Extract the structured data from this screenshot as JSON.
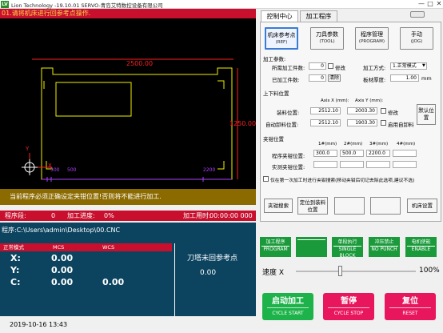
{
  "titlebar": {
    "title": "Lion Technology -19.10.01 SERVO-青岛艾特数控设备有限公司",
    "logo_text": "LV",
    "minimize": "—",
    "maximize": "□",
    "close": "✕"
  },
  "message": "01.请将机床进行回参考点操作.",
  "canvas": {
    "dim_x": "2500.00",
    "dim_y": "1250.00",
    "tick_a": "500",
    "tick_b": "500",
    "tick_c": "2200",
    "axis_x": "X",
    "axis_y": "Y"
  },
  "warning": "当前程序必须正确设定夹钳位置!否则将不能进行加工.",
  "progress": {
    "seg_label": "程序段:",
    "seg_value": "0",
    "progress_label": "加工进度:",
    "progress_value": "0%",
    "time_label": "加工用时:",
    "time_value": "00:00:00 000"
  },
  "program": {
    "path": "程序:C:\\Users\\admin\\Desktop\\00.CNC"
  },
  "coords": {
    "header_mode": "正常模式",
    "header_mcs": "MCS",
    "header_wcs": "WCS",
    "rows": [
      {
        "axis": "X:",
        "mcs": "0.00",
        "wcs": ""
      },
      {
        "axis": "Y:",
        "mcs": "0.00",
        "wcs": ""
      },
      {
        "axis": "C:",
        "mcs": "0.00",
        "wcs": "0.00"
      }
    ],
    "tool_title": "刀塔未回参考点",
    "tool_value": "0.00"
  },
  "status": {
    "datetime": "2019-10-16 13:43"
  },
  "tabs": [
    {
      "label": "控制中心"
    },
    {
      "label": "加工程序"
    }
  ],
  "modes": [
    {
      "label": "机床参考点",
      "sub": "(REF)"
    },
    {
      "label": "刀具参数",
      "sub": "(TOOL)"
    },
    {
      "label": "程序管理",
      "sub": "(PROGRAM)"
    },
    {
      "label": "手动",
      "sub": "(JOG)"
    }
  ],
  "params": {
    "section": "加工参数:",
    "total_label": "所需加工件数:",
    "total_value": "0",
    "modify": "修改",
    "done_label": "已加工件数:",
    "done_value": "0",
    "clear": "清除",
    "method_label": "加工方式:",
    "method_value": "1.正常模式",
    "thickness_label": "板材厚度:",
    "thickness_value": "1.00",
    "thickness_unit": "mm"
  },
  "loading": {
    "section": "上下料位置",
    "axisx_label": "Axis X (mm):",
    "axisy_label": "Axis Y (mm):",
    "load_label": "装料位置:",
    "load_x": "2512.10",
    "load_y": "2003.30",
    "load_mod": "修改",
    "unload_label": "自动卸料位置:",
    "unload_x": "2512.10",
    "unload_y": "1903.30",
    "unload_enable": "启用自卸料",
    "default_btn": "默认位置"
  },
  "clamps": {
    "section": "夹钳位置",
    "h1": "1#(mm)",
    "h2": "2#(mm)",
    "h3": "3#(mm)",
    "h4": "4#(mm)",
    "prog_label": "程序夹钳位置:",
    "p1": "300.0",
    "p2": "500.0",
    "p3": "2200.0",
    "p4": "",
    "actual_label": "实测夹钳位置:",
    "note": "仅在第一次加工时进行夹钳搜索(移动夹钳后切记去除此选项,建议不选)"
  },
  "bottom_buttons": {
    "search": "夹钳搜索",
    "locate": "定位到装料位置",
    "settings": "机床设置"
  },
  "green_buttons": [
    {
      "top": "加工程序",
      "bottom": "PROGRAM"
    },
    {
      "top": "",
      "bottom": ""
    },
    {
      "top": "单段执行",
      "bottom": "SINGLE BLOCK"
    },
    {
      "top": "冲压禁止",
      "bottom": "NO PUNCH"
    },
    {
      "top": "电机使能",
      "bottom": "ENABLE"
    }
  ],
  "speed": {
    "label": "速度 X",
    "value": "100%",
    "level": 0.35
  },
  "actions": [
    {
      "label": "启动加工",
      "sub": "CYCLE START",
      "color": "#1db34a"
    },
    {
      "label": "暂停",
      "sub": "CYCLE STOP",
      "color": "#e8175d"
    },
    {
      "label": "复位",
      "sub": "RESET",
      "color": "#e8175d"
    }
  ]
}
